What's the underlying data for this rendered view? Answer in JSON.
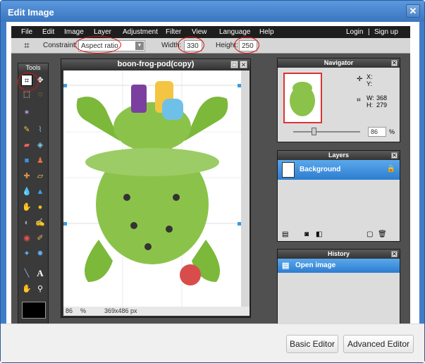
{
  "dialog": {
    "title": "Edit Image",
    "close": "✕"
  },
  "menu": [
    "File",
    "Edit",
    "Image",
    "Layer",
    "Adjustment",
    "Filter",
    "View",
    "Language",
    "Help"
  ],
  "auth": {
    "login": "Login",
    "sep": "|",
    "signup": "Sign up"
  },
  "toolbar": {
    "constraint_label": "Constraint:",
    "constraint_value": "Aspect ratio",
    "width_label": "Width:",
    "width_value": "330",
    "height_label": "Height:",
    "height_value": "250"
  },
  "tools": {
    "title": "Tools"
  },
  "canvas": {
    "title": "boon-frog-pod(copy)",
    "zoom": "86",
    "zoom_unit": "%",
    "size": "369x486 px"
  },
  "navigator": {
    "title": "Navigator",
    "x_label": "X:",
    "y_label": "Y:",
    "w_label": "W:",
    "w_value": "368",
    "h_label": "H:",
    "h_value": "279",
    "zoom": "86",
    "zoom_unit": "%"
  },
  "layers": {
    "title": "Layers",
    "items": [
      "Background"
    ]
  },
  "history": {
    "title": "History",
    "items": [
      "Open image"
    ]
  },
  "footer": {
    "basic": "Basic Editor",
    "advanced": "Advanced Editor"
  },
  "colors": {
    "accent": "#3a76c0",
    "selection": "#2d7dd0",
    "frog": "#8bc34a",
    "annotation": "#e01010"
  }
}
